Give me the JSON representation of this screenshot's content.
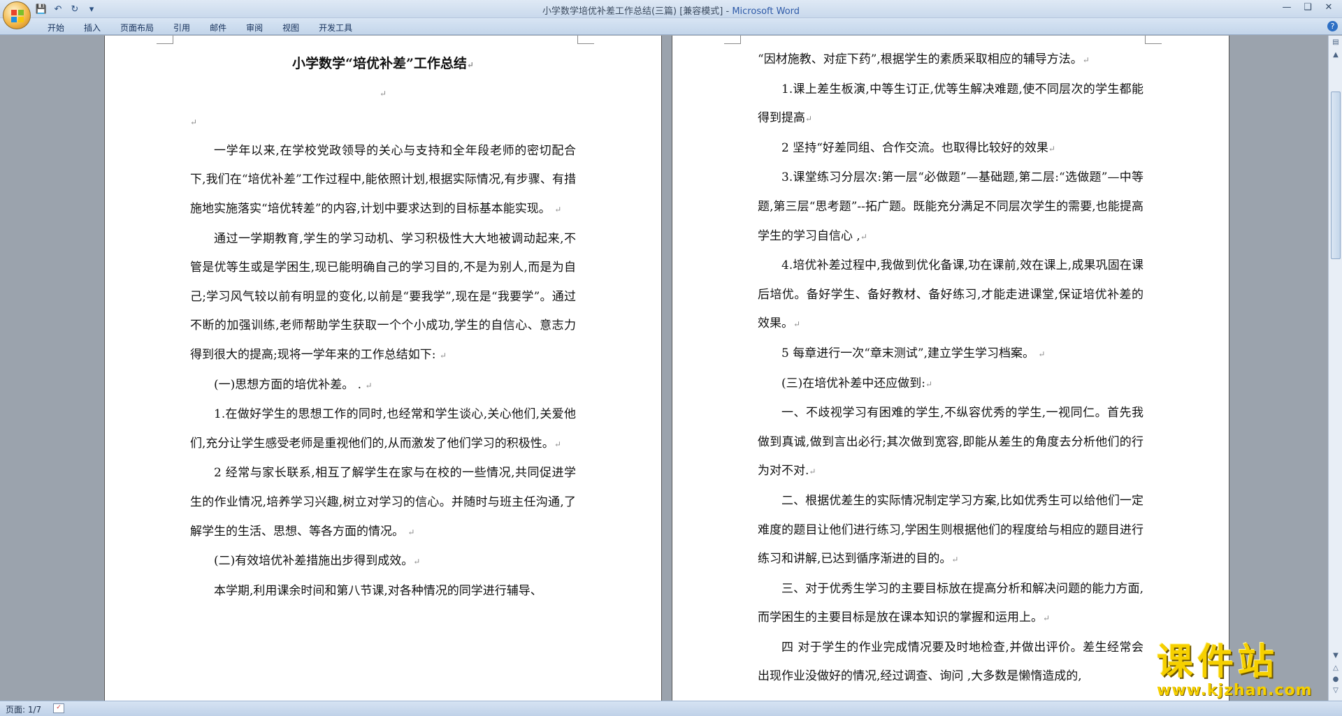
{
  "window": {
    "title": "小学数学培优补差工作总结(三篇) [兼容模式]",
    "app_name": "Microsoft Word",
    "controls": [
      "minimize-icon",
      "restore-icon",
      "close-icon"
    ]
  },
  "quick_access": [
    "save-icon",
    "undo-icon",
    "redo-icon",
    "customize-icon"
  ],
  "ribbon": {
    "tabs": [
      "开始",
      "插入",
      "页面布局",
      "引用",
      "邮件",
      "审阅",
      "视图",
      "开发工具"
    ]
  },
  "left_page": {
    "title": "小学数学“培优补差”工作总结",
    "paragraphs": [
      "一学年以来,在学校党政领导的关心与支持和全年段老师的密切配合下,我们在“培优补差”工作过程中,能依照计划,根据实际情况,有步骤、有措施地实施落实“培优转差”的内容,计划中要求达到的目标基本能实现。",
      "通过一学期教育,学生的学习动机、学习积极性大大地被调动起来,不管是优等生或是学困生,现已能明确自己的学习目的,不是为别人,而是为自己;学习风气较以前有明显的变化,以前是“要我学”,现在是“我要学”。通过不断的加强训练,老师帮助学生获取一个个小成功,学生的自信心、意志力得到很大的提高;现将一学年来的工作总结如下:",
      "(一)思想方面的培优补差。 .",
      "1.在做好学生的思想工作的同时,也经常和学生谈心,关心他们,关爱他们,充分让学生感受老师是重视他们的,从而激发了他们学习的积极性。",
      "2 经常与家长联系,相互了解学生在家与在校的一些情况,共同促进学生的作业情况,培养学习兴趣,树立对学习的信心。并随时与班主任沟通,了解学生的生活、思想、等各方面的情况。",
      "(二)有效培优补差措施出步得到成效。",
      "本学期,利用课余时间和第八节课,对各种情况的同学进行辅导、"
    ]
  },
  "right_page": {
    "paragraphs": [
      "“因材施教、对症下药”,根据学生的素质采取相应的辅导方法。",
      "1.课上差生板演,中等生订正,优等生解决难题,使不同层次的学生都能得到提高",
      "2 坚持“好差同组、合作交流。也取得比较好的效果",
      "3.课堂练习分层次:第一层“必做题”—基础题,第二层:“选做题”—中等题,第三层“思考题”--拓广题。既能充分满足不同层次学生的需要,也能提高学生的学习自信心 ,",
      "4.培优补差过程中,我做到优化备课,功在课前,效在课上,成果巩固在课后培优。备好学生、备好教材、备好练习,才能走进课堂,保证培优补差的效果。",
      "5 每章进行一次“章末测试”,建立学生学习档案。",
      "(三)在培优补差中还应做到:",
      "一、不歧视学习有困难的学生,不纵容优秀的学生,一视同仁。首先我做到真诚,做到言出必行;其次做到宽容,即能从差生的角度去分析他们的行为对不对.",
      "二、根据优差生的实际情况制定学习方案,比如优秀生可以给他们一定难度的题目让他们进行练习,学困生则根据他们的程度给与相应的题目进行练习和讲解,已达到循序渐进的目的。",
      "三、对于优秀生学习的主要目标放在提高分析和解决问题的能力方面,而学困生的主要目标是放在课本知识的掌握和运用上。",
      "四 对于学生的作业完成情况要及时地检查,并做出评价。差生经常会出现作业没做好的情况,经过调查、询问 ,大多数是懒惰造成的,"
    ]
  },
  "statusbar": {
    "page_count": "页面: 1/7"
  },
  "watermark": {
    "text": "课件站",
    "url": "www.kjzhan.com"
  }
}
